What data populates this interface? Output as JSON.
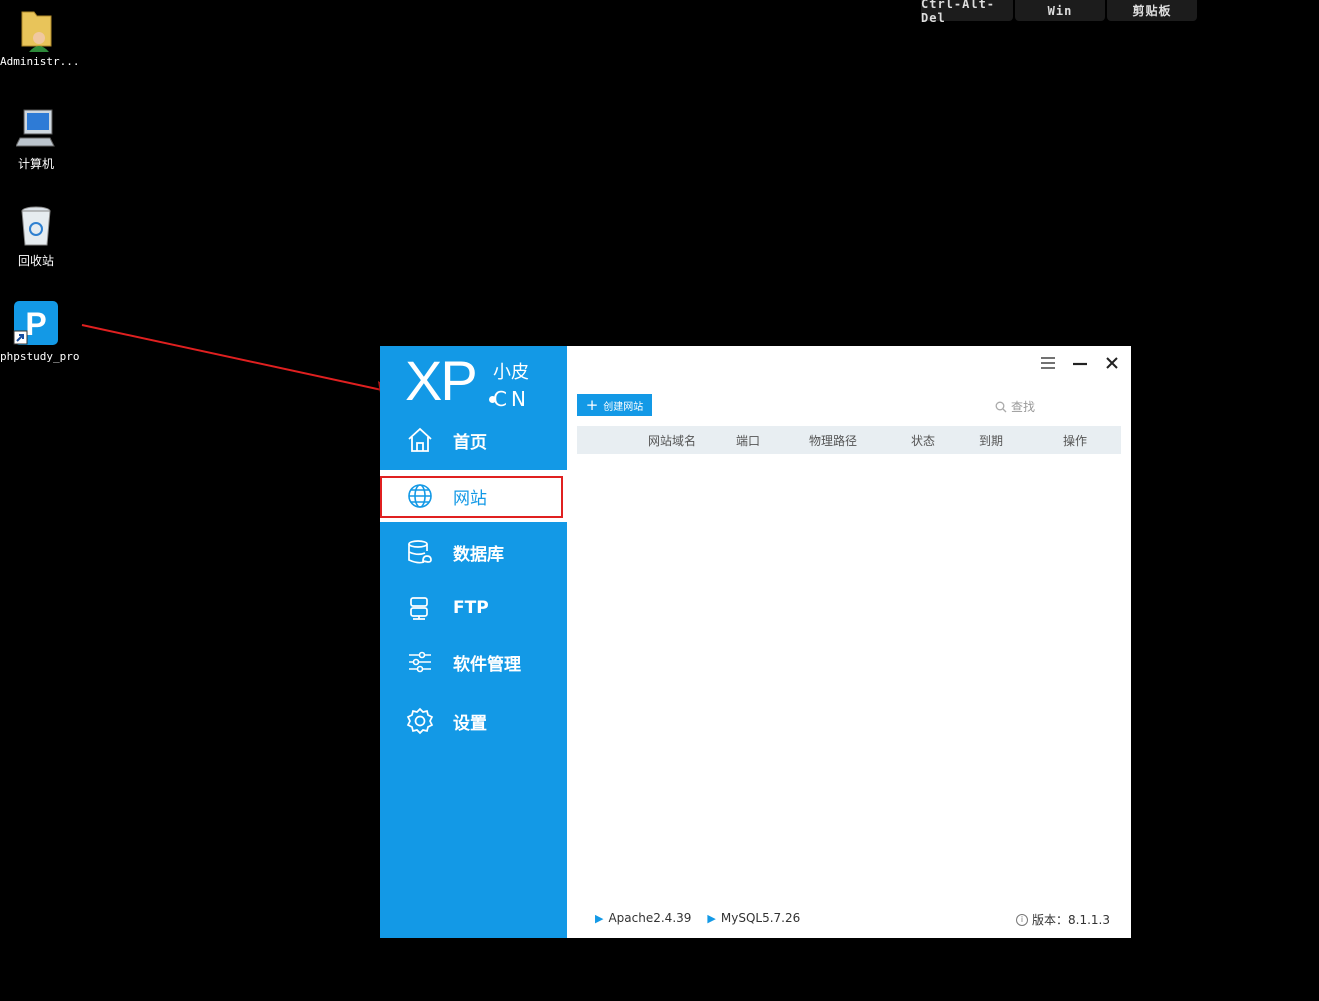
{
  "remote_toolbar": {
    "ctrl_alt_del": "Ctrl-Alt-Del",
    "win": "Win",
    "clipboard": "剪贴板"
  },
  "desktop": {
    "icons": [
      {
        "label": "Administr...",
        "icon": "user-folder-icon"
      },
      {
        "label": "计算机",
        "icon": "computer-icon"
      },
      {
        "label": "回收站",
        "icon": "recycle-bin-icon"
      },
      {
        "label": "phpstudy_pro",
        "icon": "phpstudy-shortcut-icon"
      }
    ]
  },
  "app": {
    "logo": {
      "main": "XP",
      "cn_top": "小皮",
      "cn_bottom": "CN"
    },
    "nav": [
      {
        "label": "首页",
        "icon": "home-icon"
      },
      {
        "label": "网站",
        "icon": "globe-icon"
      },
      {
        "label": "数据库",
        "icon": "database-icon"
      },
      {
        "label": "FTP",
        "icon": "ftp-icon"
      },
      {
        "label": "软件管理",
        "icon": "sliders-icon"
      },
      {
        "label": "设置",
        "icon": "gear-icon"
      }
    ],
    "active_nav": "网站",
    "create_button": "创建网站",
    "search_placeholder": "查找",
    "table_headers": [
      "网站域名",
      "端口",
      "物理路径",
      "状态",
      "到期",
      "操作"
    ],
    "footer": {
      "apache": "Apache2.4.39",
      "mysql": "MySQL5.7.26",
      "version": "版本：8.1.1.3"
    },
    "colors": {
      "accent": "#1399e6",
      "highlight": "#e02020"
    }
  }
}
